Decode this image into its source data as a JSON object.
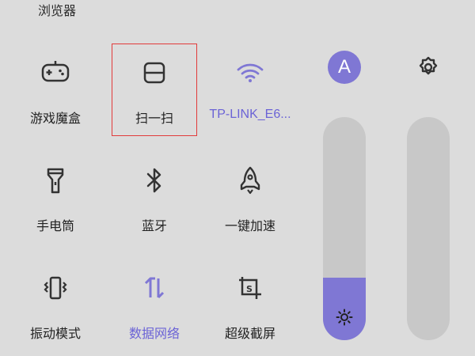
{
  "header": {
    "label": "浏览器"
  },
  "tiles": [
    {
      "id": "game-box",
      "label": "游戏魔盒",
      "icon": "gamepad-icon"
    },
    {
      "id": "scan",
      "label": "扫一扫",
      "icon": "scan-icon"
    },
    {
      "id": "wifi",
      "label": "TP-LINK_E6...",
      "icon": "wifi-icon",
      "active": true
    },
    {
      "id": "flashlight",
      "label": "手电筒",
      "icon": "flashlight-icon"
    },
    {
      "id": "bluetooth",
      "label": "蓝牙",
      "icon": "bluetooth-icon"
    },
    {
      "id": "speed-boost",
      "label": "一键加速",
      "icon": "rocket-icon"
    },
    {
      "id": "vibrate",
      "label": "振动模式",
      "icon": "vibrate-icon"
    },
    {
      "id": "mobile-data",
      "label": "数据网络",
      "icon": "data-arrows-icon",
      "active": true
    },
    {
      "id": "screenshot",
      "label": "超级截屏",
      "icon": "screenshot-icon"
    }
  ],
  "account": {
    "initial": "A"
  },
  "brightness": {
    "level": 0.28
  },
  "volume": {
    "level": 0
  },
  "colors": {
    "accent": "#7f77d4",
    "highlight": "#e23b3b",
    "background": "#dcdcdc"
  }
}
